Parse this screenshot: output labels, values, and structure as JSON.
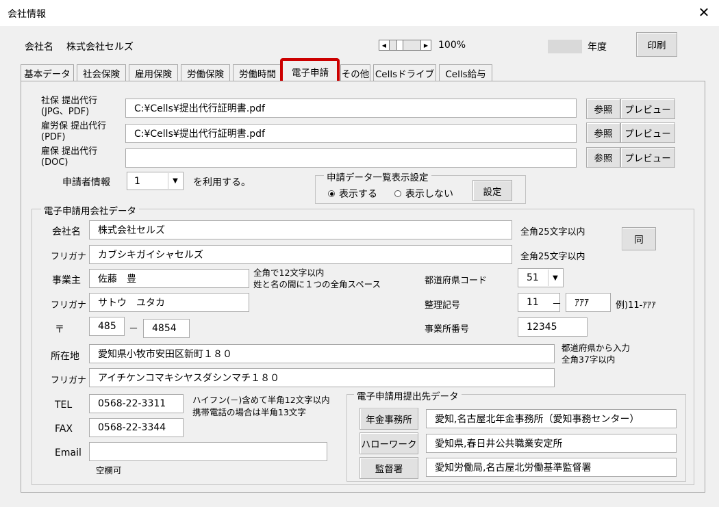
{
  "window": {
    "title": "会社情報",
    "close_glyph": "✕"
  },
  "header": {
    "company_label": "会社名",
    "company_name": "株式会社セルズ",
    "zoom": "100%",
    "year_suffix": "年度",
    "print_label": "印刷"
  },
  "tabs": [
    "基本データ",
    "社会保険",
    "雇用保険",
    "労働保険",
    "労働時間",
    "電子申請",
    "その他",
    "Cellsドライブ",
    "Cells給与"
  ],
  "files": [
    {
      "label1": "社保 提出代行",
      "label2": "(JPG、PDF)",
      "value": "C:¥Cells¥提出代行証明書.pdf",
      "browse": "参照",
      "preview": "プレビュー"
    },
    {
      "label1": "雇労保 提出代行",
      "label2": "(PDF)",
      "value": "C:¥Cells¥提出代行証明書.pdf",
      "browse": "参照",
      "preview": "プレビュー"
    },
    {
      "label1": "雇保 提出代行",
      "label2": "(DOC)",
      "value": "",
      "browse": "参照",
      "preview": "プレビュー"
    }
  ],
  "applicant": {
    "label": "申請者情報",
    "value": "1",
    "suffix": "を利用する。"
  },
  "list_setting": {
    "title": "申請データ一覧表示設定",
    "show": "表示する",
    "hide": "表示しない",
    "selected": "show",
    "button": "設定"
  },
  "company_data": {
    "title": "電子申請用会社データ",
    "name_label": "会社名",
    "name": "株式会社セルズ",
    "name_note": "全角25文字以内",
    "same_button": "同",
    "furigana_label": "フリガナ",
    "furigana": "カブシキガイシャセルズ",
    "furigana_note": "全角25文字以内",
    "owner_label": "事業主",
    "owner": "佐藤　豊",
    "owner_note1": "全角で12文字以内",
    "owner_note2": "姓と名の間に１つの全角スペース",
    "owner_kana_label": "フリガナ",
    "owner_kana": "サトウ　ユタカ",
    "postal_label": "〒",
    "postal1": "485",
    "postal_dash": "－",
    "postal2": "4854",
    "pref_code_label": "都道府県コード",
    "pref_code": "51",
    "ref_no_label": "整理記号",
    "ref_no1": "11",
    "ref_dash": "－",
    "ref_no2": "ｱｱｱ",
    "ref_example": "例)11-ｱｱｱ",
    "office_no_label": "事業所番号",
    "office_no": "12345",
    "address_label": "所在地",
    "address": "愛知県小牧市安田区新町１８０",
    "address_note1": "都道府県から入力",
    "address_note2": "全角37字以内",
    "address_kana_label": "フリガナ",
    "address_kana": "アイチケンコマキシヤスダシンマチ１８０",
    "tel_label": "TEL",
    "tel": "0568-22-3311",
    "tel_note1": "ハイフン(－)含めて半角12文字以内",
    "tel_note2": "携帯電話の場合は半角13文字",
    "fax_label": "FAX",
    "fax": "0568-22-3344",
    "email_label": "Email",
    "email": "",
    "email_note": "空欄可"
  },
  "submit_dest": {
    "title": "電子申請用提出先データ",
    "rows": [
      {
        "button": "年金事務所",
        "value": "愛知,名古屋北年金事務所（愛知事務センター）"
      },
      {
        "button": "ハローワーク",
        "value": "愛知県,春日井公共職業安定所"
      },
      {
        "button": "監督署",
        "value": "愛知労働局,名古屋北労働基準監督署"
      }
    ]
  },
  "colors": {
    "highlight": "#cc0000",
    "background": "#f0f0f0"
  }
}
